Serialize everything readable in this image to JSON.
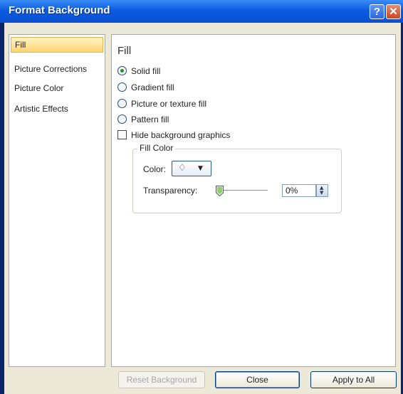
{
  "window": {
    "title": "Format Background",
    "help_glyph": "?",
    "close_glyph": "✕"
  },
  "nav": {
    "items": [
      {
        "label": "Fill",
        "selected": true
      },
      {
        "label": "Picture Corrections"
      },
      {
        "label": "Picture Color"
      },
      {
        "label": "Artistic Effects"
      }
    ]
  },
  "panel": {
    "title": "Fill",
    "options": [
      {
        "label": "Solid fill",
        "checked": true
      },
      {
        "label": "Gradient fill"
      },
      {
        "label": "Picture or texture fill"
      },
      {
        "label": "Pattern fill"
      }
    ],
    "hide_background_graphics": {
      "label": "Hide background graphics",
      "checked": false
    },
    "fill_color": {
      "legend": "Fill Color",
      "color_label": "Color:",
      "transparency_label": "Transparency:",
      "transparency_value": "0%"
    }
  },
  "buttons": {
    "reset": "Reset Background",
    "close": "Close",
    "apply": "Apply to All"
  },
  "colors": {
    "accent": "#ffd56e",
    "titlebar": "#0b5ce3",
    "radio_dot": "#2b8a2b"
  }
}
